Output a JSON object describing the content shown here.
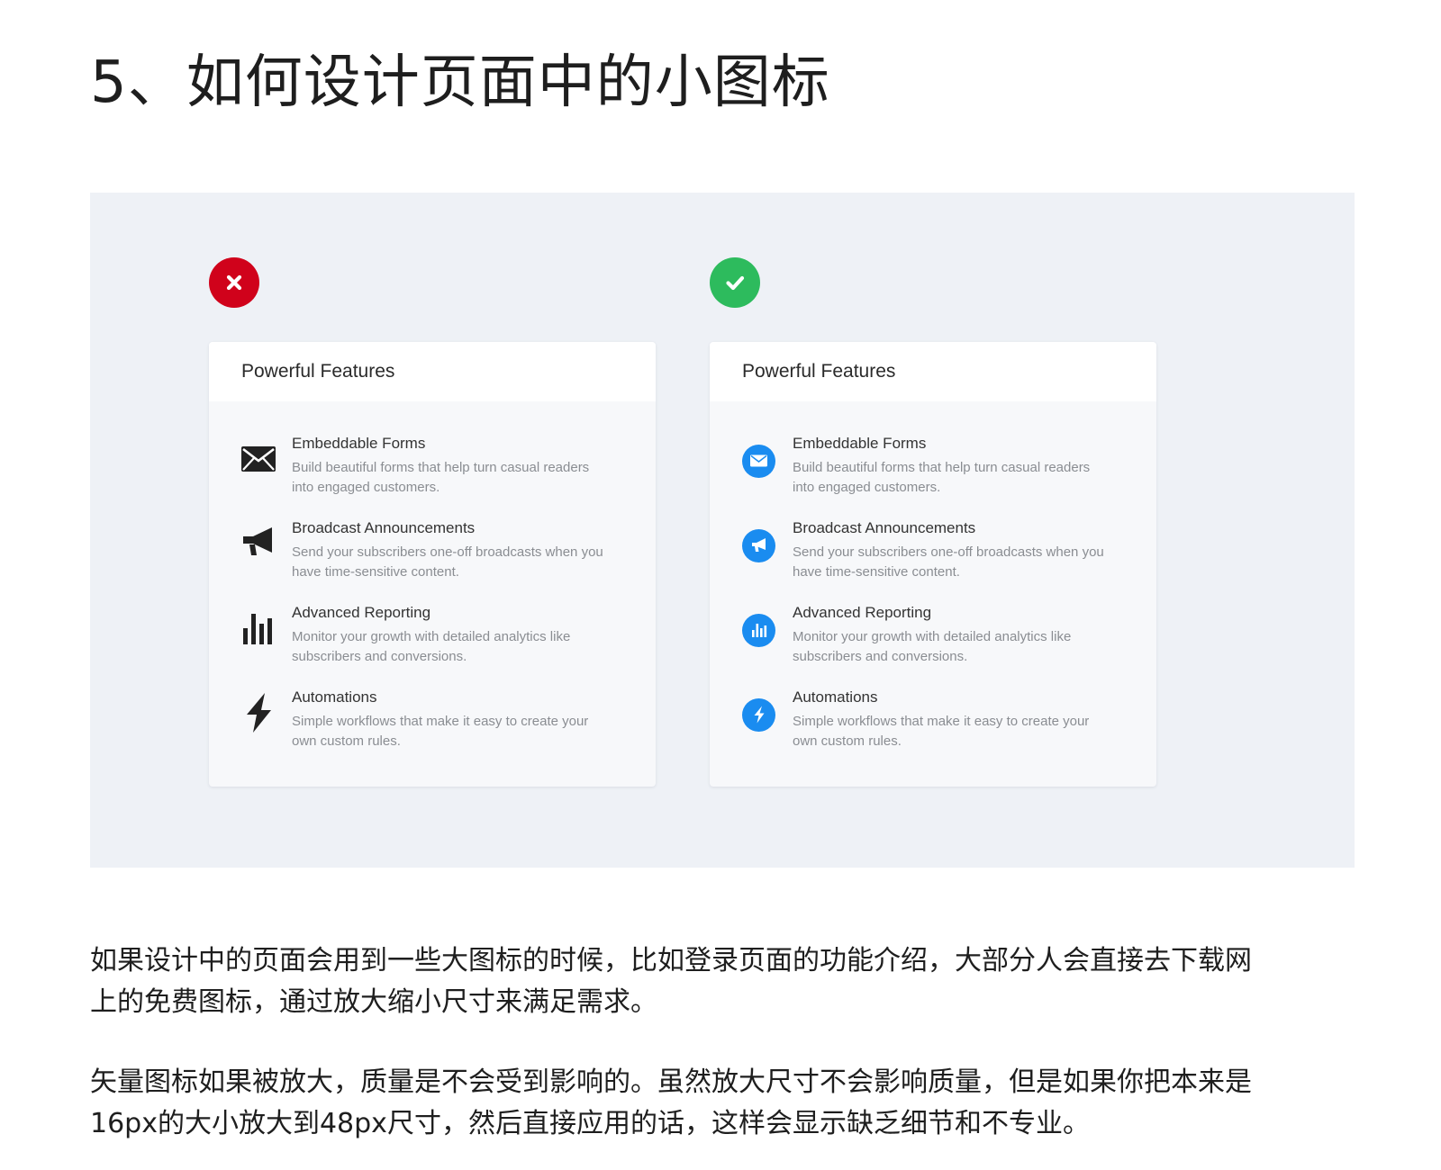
{
  "page_title": "5、如何设计页面中的小图标",
  "colors": {
    "wrong_badge": "#d0021b",
    "right_badge": "#2dbb5d",
    "accent_blue": "#1a8cf0",
    "mono_icon": "#222222"
  },
  "left_card": {
    "badge_icon": "close-icon",
    "title": "Powerful Features",
    "features": [
      {
        "icon": "envelope-icon",
        "title": "Embeddable Forms",
        "desc_line1": "Build beautiful forms that help turn casual readers",
        "desc_line2": "into engaged customers."
      },
      {
        "icon": "megaphone-icon",
        "title": "Broadcast Announcements",
        "desc_line1": "Send your subscribers one-off broadcasts when you",
        "desc_line2": "have time-sensitive content."
      },
      {
        "icon": "bar-chart-icon",
        "title": "Advanced Reporting",
        "desc_line1": "Monitor your growth with detailed analytics like",
        "desc_line2": "subscribers and conversions."
      },
      {
        "icon": "lightning-icon",
        "title": "Automations",
        "desc_line1": "Simple workflows that make it easy to create your",
        "desc_line2": "own custom rules."
      }
    ]
  },
  "right_card": {
    "badge_icon": "check-icon",
    "title": "Powerful Features",
    "features": [
      {
        "icon": "envelope-icon",
        "title": "Embeddable Forms",
        "desc_line1": "Build beautiful forms that help turn casual readers",
        "desc_line2": "into engaged customers."
      },
      {
        "icon": "megaphone-icon",
        "title": "Broadcast Announcements",
        "desc_line1": "Send your subscribers one-off broadcasts when you",
        "desc_line2": "have time-sensitive content."
      },
      {
        "icon": "bar-chart-icon",
        "title": "Advanced Reporting",
        "desc_line1": "Monitor your growth with detailed analytics like",
        "desc_line2": "subscribers and conversions."
      },
      {
        "icon": "lightning-icon",
        "title": "Automations",
        "desc_line1": "Simple workflows that make it easy to create your",
        "desc_line2": "own custom rules."
      }
    ]
  },
  "paragraphs": [
    {
      "line1": "如果设计中的页面会用到一些大图标的时候，比如登录页面的功能介绍，大部分人会直接去下载网",
      "line2": "上的免费图标，通过放大缩小尺寸来满足需求。"
    },
    {
      "line1": "矢量图标如果被放大，质量是不会受到影响的。虽然放大尺寸不会影响质量，但是如果你把本来是",
      "line2": "16px的大小放大到48px尺寸，然后直接应用的话，这样会显示缺乏细节和不专业。"
    }
  ]
}
